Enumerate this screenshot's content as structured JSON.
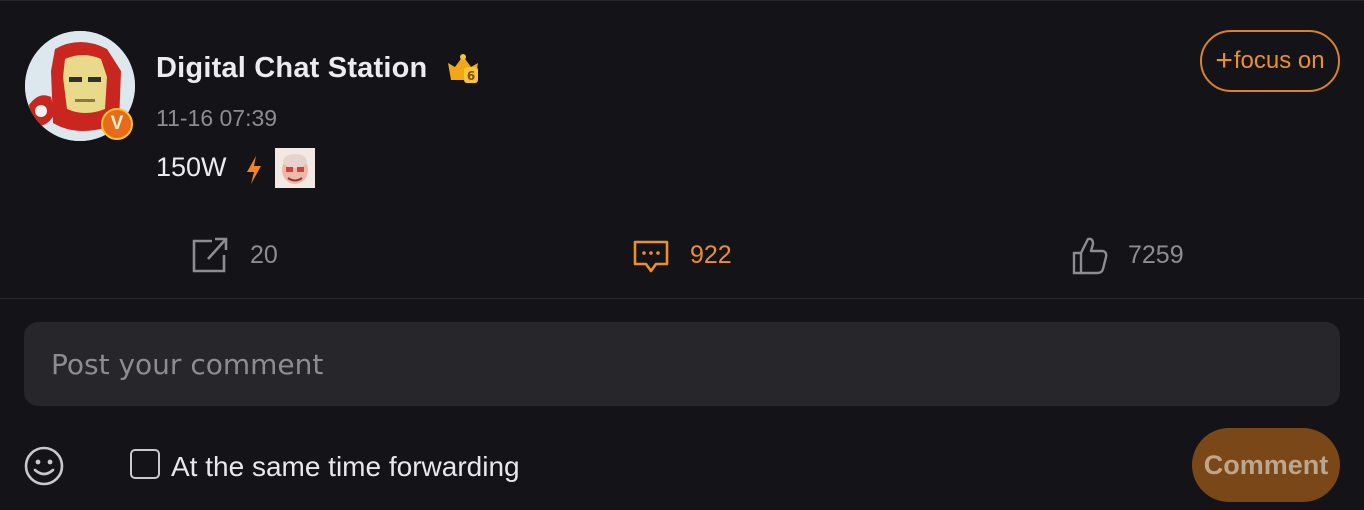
{
  "post": {
    "username": "Digital Chat Station",
    "timestamp": "11-16 07:39",
    "text": "150W",
    "verified_badge": "V",
    "crown_level": "6",
    "follow_label": "focus on",
    "follow_icon": "+"
  },
  "actions": {
    "share_count": "20",
    "comment_count": "922",
    "like_count": "7259"
  },
  "composer": {
    "placeholder": "Post your comment",
    "forward_label": "At the same time forwarding",
    "forward_checked": false,
    "submit_label": "Comment"
  },
  "colors": {
    "background": "#141418",
    "accent": "#e98f2e",
    "muted": "#8c8c92",
    "input_bg": "#26262b",
    "submit_bg": "#7a4818"
  },
  "icons": {
    "avatar": "iron-man-avatar",
    "verified": "verified-badge-icon",
    "crown": "crown-icon",
    "bolt": "lightning-bolt-icon",
    "sticker": "sticker-emoji",
    "share": "share-icon",
    "comment": "comment-icon",
    "like": "thumbs-up-icon",
    "emoji": "smiley-icon"
  }
}
